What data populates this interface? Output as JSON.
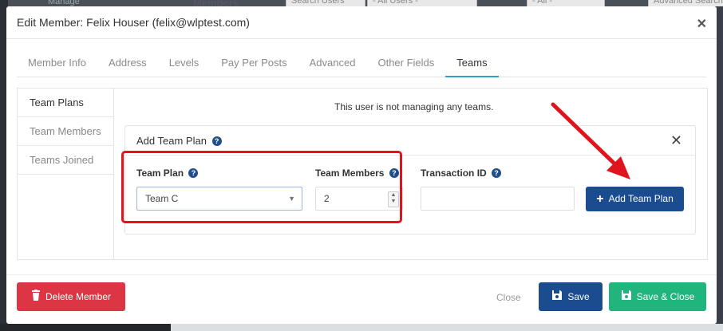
{
  "background": {
    "page_title": "Members",
    "nav_label": "Manage",
    "search_placeholder": "Search Users",
    "filter_users": "- All Users -",
    "filter_all": "- All -",
    "advanced_search": "Advanced Search"
  },
  "modal": {
    "title": "Edit Member: Felix Houser (felix@wlptest.com)",
    "tabs": [
      {
        "label": "Member Info"
      },
      {
        "label": "Address"
      },
      {
        "label": "Levels"
      },
      {
        "label": "Pay Per Posts"
      },
      {
        "label": "Advanced"
      },
      {
        "label": "Other Fields"
      },
      {
        "label": "Teams"
      }
    ],
    "active_tab": "Teams",
    "sidenav": [
      {
        "label": "Team Plans"
      },
      {
        "label": "Team Members"
      },
      {
        "label": "Teams Joined"
      }
    ],
    "notice": "This user is not managing any teams.",
    "add_team_plan": {
      "title": "Add Team Plan",
      "team_plan_label": "Team Plan",
      "team_plan_value": "Team C",
      "team_members_label": "Team Members",
      "team_members_value": "2",
      "transaction_id_label": "Transaction ID",
      "transaction_id_value": "",
      "add_button": "Add Team Plan"
    },
    "footer": {
      "delete": "Delete Member",
      "close": "Close",
      "save": "Save",
      "save_close": "Save & Close"
    }
  },
  "colors": {
    "primary": "#1a4c8f",
    "danger": "#dc3544",
    "success": "#20b57c",
    "annotation": "#e0141c",
    "active_tab_underline": "#2fa4c9"
  },
  "icons": {
    "help": "question-circle-icon",
    "close": "close-icon",
    "plus": "plus-icon",
    "trash": "trash-icon",
    "save": "floppy-disk-icon",
    "annotation_arrow": "red-arrow-icon"
  }
}
